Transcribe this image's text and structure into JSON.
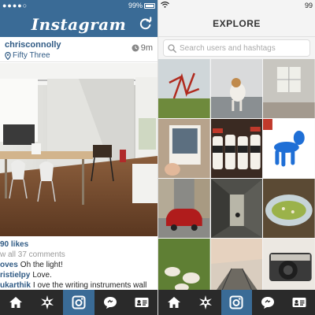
{
  "feed": {
    "status": {
      "carrier": "●●●●○ ",
      "battery": "99%"
    },
    "header": {
      "logo": "Instagram",
      "refresh_icon": "refresh-icon"
    },
    "post": {
      "username": "chrisconnolly",
      "location": "Fifty Three",
      "time": "9m",
      "likes": "90 likes",
      "view_all": "w all 37 comments",
      "comments": [
        {
          "user": "oves",
          "text": "Oh the light!"
        },
        {
          "user": "ristielpy",
          "text": "Love."
        },
        {
          "user": "ukarthik",
          "text": "I ove the writing instruments wall"
        }
      ]
    },
    "tabs": [
      {
        "name": "home-icon",
        "active": false
      },
      {
        "name": "explore-star-icon",
        "active": false
      },
      {
        "name": "camera-icon",
        "active": true
      },
      {
        "name": "news-bubble-icon",
        "active": false
      },
      {
        "name": "profile-card-icon",
        "active": false
      }
    ]
  },
  "explore": {
    "status": {
      "battery": "99"
    },
    "title": "EXPLORE",
    "search": {
      "placeholder": "Search users and hashtags",
      "value": ""
    },
    "grid_subjects": [
      "red-sculpture",
      "beagle",
      "empty-room",
      "polaroid",
      "milk-bottles",
      "balloon-dog",
      "red-car",
      "alley",
      "guacamole",
      "sheep",
      "boardwalk",
      "camera"
    ],
    "milk_labels": [
      "FULL",
      "SOUR",
      "ALL",
      "SPOT",
      "CREAM"
    ],
    "tabs": [
      {
        "name": "home-icon",
        "active": false
      },
      {
        "name": "explore-star-icon",
        "active": true
      },
      {
        "name": "camera-icon",
        "active": false
      },
      {
        "name": "news-bubble-icon",
        "active": false
      },
      {
        "name": "profile-card-icon",
        "active": false
      }
    ]
  },
  "colors": {
    "brand": "#3a6b96",
    "link": "#2f5a84",
    "tabbar": "#2a2a2a"
  }
}
